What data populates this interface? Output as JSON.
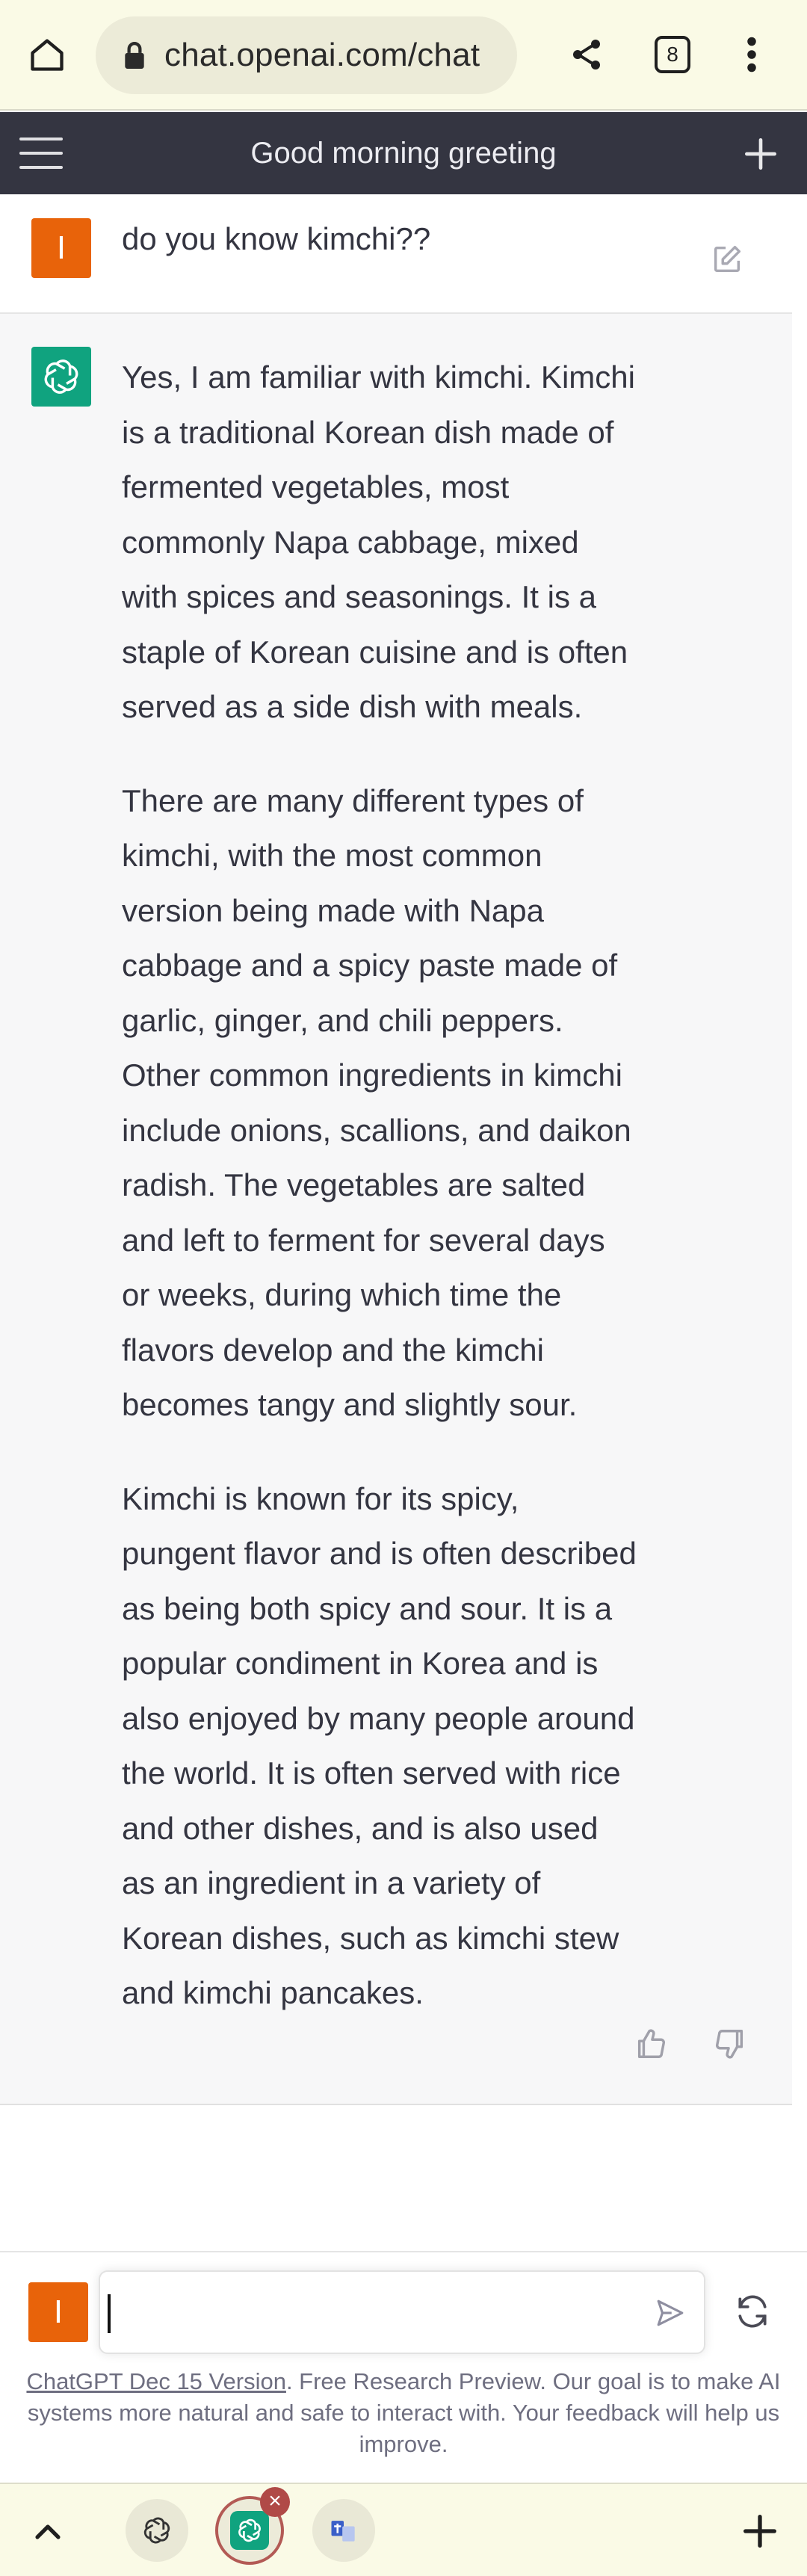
{
  "browser": {
    "url": "chat.openai.com/chat",
    "tab_count": "8"
  },
  "header": {
    "title": "Good morning greeting"
  },
  "conversation": {
    "user_avatar_letter": "I",
    "user_message": "do you know kimchi??",
    "assistant_paragraphs": [
      "Yes, I am familiar with kimchi. Kimchi is a traditional Korean dish made of fermented vegetables, most commonly Napa cabbage, mixed with spices and seasonings. It is a staple of Korean cuisine and is often served as a side dish with meals.",
      "There are many different types of kimchi, with the most common version being made with Napa cabbage and a spicy paste made of garlic, ginger, and chili peppers. Other common ingredients in kimchi include onions, scallions, and daikon radish. The vegetables are salted and left to ferment for several days or weeks, during which time the flavors develop and the kimchi becomes tangy and slightly sour.",
      "Kimchi is known for its spicy, pungent flavor and is often described as being both spicy and sour. It is a popular condiment in Korea and is also enjoyed by many people around the world. It is often served with rice and other dishes, and is also used as an ingredient in a variety of Korean dishes, such as kimchi stew and kimchi pancakes."
    ]
  },
  "composer": {
    "value": "",
    "version_link": "ChatGPT Dec 15 Version",
    "disclaimer": ". Free Research Preview. Our goal is to make AI systems more natural and safe to interact with. Your feedback will help us improve."
  },
  "colors": {
    "header_bg": "#343541",
    "user_avatar": "#e8630a",
    "assistant_avatar": "#10a37f",
    "assistant_bg": "#f7f7f8",
    "browser_bar": "#fafae6"
  },
  "icons": [
    "home-icon",
    "lock-icon",
    "share-icon",
    "tabs-counter-icon",
    "more-vert-icon",
    "hamburger-icon",
    "new-chat-icon",
    "edit-icon",
    "openai-logo-icon",
    "thumbs-up-icon",
    "thumbs-down-icon",
    "send-icon",
    "regenerate-icon",
    "chevron-up-icon",
    "plus-icon"
  ]
}
